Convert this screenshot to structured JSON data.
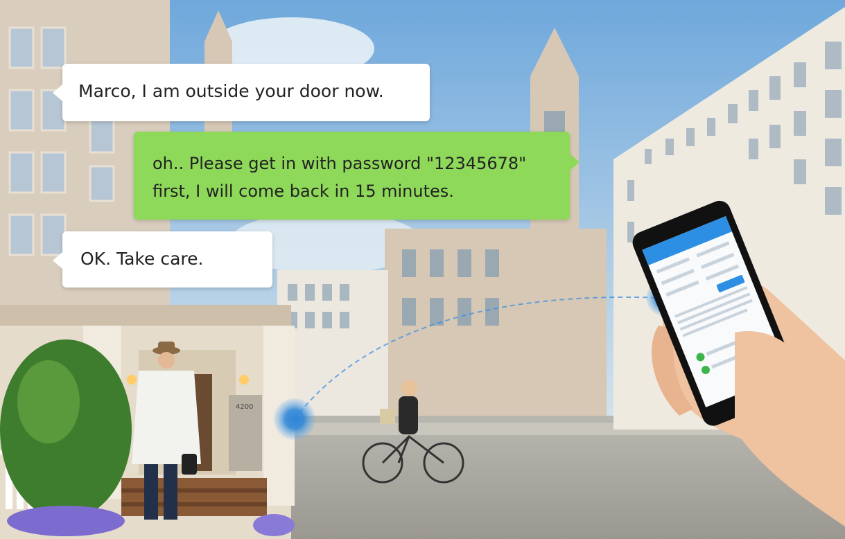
{
  "chat": {
    "message_1": "Marco, I am outside your door now.",
    "message_2_line_1": "oh.. Please get in with password \"12345678\"",
    "message_2_line_2": "first, I will come back in 15 minutes.",
    "message_3": "OK. Take care."
  },
  "scene": {
    "house_number": "4200"
  },
  "colors": {
    "reply_bubble": "#8fd95a",
    "incoming_bubble": "#ffffff",
    "signal_dot": "#2f86d8",
    "phone_header": "#2d8fe3"
  }
}
